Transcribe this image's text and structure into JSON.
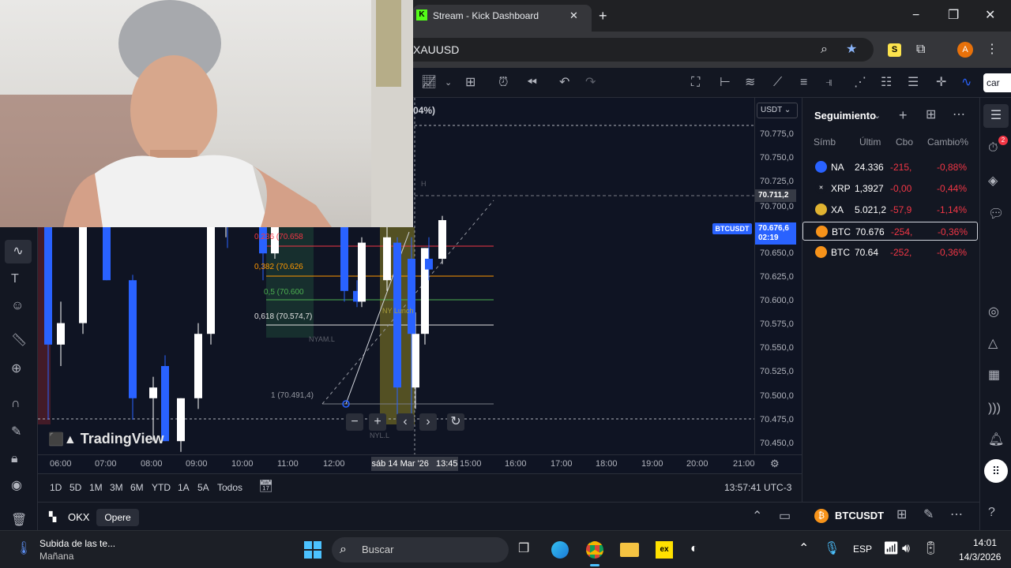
{
  "browser": {
    "tab_title": "Stream - Kick Dashboard",
    "address": "XAUUSD",
    "profile_initial": "A"
  },
  "toolbar": {
    "search_button": "car"
  },
  "chart": {
    "percent_partial": "04%)",
    "currency": "USDT",
    "symbol_badge": "BTCUSDT",
    "current_price": "70.676,6",
    "countdown": "02:19",
    "crosshair_price": "70.711,2",
    "watermark": "TradingView",
    "fib": {
      "l0236": "0,236 (70.658",
      "l0382": "0,382 (70.626",
      "l05": "0,5 (70.600",
      "l0618": "0,618 (70.574,7)",
      "l1": "1 (70.491,4)"
    },
    "labels": {
      "nyam": "NYAM.L",
      "nylunch": "NY Lunch",
      "nyl": "NYL.L",
      "h": "H"
    },
    "price_ticks": [
      "70.775,0",
      "70.750,0",
      "70.725,0",
      "70.700,0",
      "70.650,0",
      "70.625,0",
      "70.600,0",
      "70.575,0",
      "70.550,0",
      "70.525,0",
      "70.500,0",
      "70.475,0",
      "70.450,0"
    ],
    "time_ticks": [
      "06:00",
      "07:00",
      "08:00",
      "09:00",
      "10:00",
      "11:00",
      "12:00",
      "15:00",
      "16:00",
      "17:00",
      "18:00",
      "19:00",
      "20:00",
      "21:00"
    ],
    "crosshair_date": "sáb 14 Mar '26",
    "crosshair_time": "13:45"
  },
  "chart_data": {
    "type": "candlestick",
    "title": "BTCUSDT",
    "ylim": [
      70440,
      70790
    ],
    "candles": [
      {
        "t": "05:45",
        "o": 70560,
        "h": 70690,
        "l": 70490,
        "c": 70680,
        "dir": "down"
      },
      {
        "t": "06:00",
        "o": 70560,
        "h": 70600,
        "l": 70540,
        "c": 70580,
        "dir": "up"
      },
      {
        "t": "06:15",
        "o": 70580,
        "h": 70690,
        "l": 70570,
        "c": 70690,
        "dir": "up"
      },
      {
        "t": "06:30",
        "o": 70690,
        "h": 70710,
        "l": 70620,
        "c": 70620,
        "dir": "down"
      },
      {
        "t": "06:45",
        "o": 70620,
        "h": 70625,
        "l": 70490,
        "c": 70510,
        "dir": "down"
      },
      {
        "t": "07:00",
        "o": 70510,
        "h": 70530,
        "l": 70470,
        "c": 70520,
        "dir": "up"
      },
      {
        "t": "07:15",
        "o": 70540,
        "h": 70550,
        "l": 70470,
        "c": 70470,
        "dir": "down"
      },
      {
        "t": "07:30",
        "o": 70470,
        "h": 70510,
        "l": 70460,
        "c": 70510,
        "dir": "up"
      },
      {
        "t": "07:45",
        "o": 70510,
        "h": 70580,
        "l": 70500,
        "c": 70570,
        "dir": "up"
      },
      {
        "t": "08:00",
        "o": 70570,
        "h": 70690,
        "l": 70560,
        "c": 70680,
        "dir": "up"
      },
      {
        "t": "08:15",
        "o": 70680,
        "h": 70700,
        "l": 70650,
        "c": 70670,
        "dir": "down"
      },
      {
        "t": "08:30",
        "o": 70670,
        "h": 70700,
        "l": 70660,
        "c": 70700,
        "dir": "up"
      },
      {
        "t": "09:30",
        "o": 70690,
        "h": 70700,
        "l": 70620,
        "c": 70645,
        "dir": "down"
      },
      {
        "t": "09:45",
        "o": 70645,
        "h": 70700,
        "l": 70640,
        "c": 70690,
        "dir": "up"
      },
      {
        "t": "11:30",
        "o": 70690,
        "h": 70700,
        "l": 70600,
        "c": 70610,
        "dir": "down"
      },
      {
        "t": "11:45",
        "o": 70610,
        "h": 70620,
        "l": 70595,
        "c": 70600,
        "dir": "down"
      },
      {
        "t": "12:00",
        "o": 70600,
        "h": 70660,
        "l": 70595,
        "c": 70655,
        "dir": "up"
      },
      {
        "t": "12:15",
        "o": 70660,
        "h": 70680,
        "l": 70610,
        "c": 70620,
        "dir": "up"
      },
      {
        "t": "12:30",
        "o": 70655,
        "h": 70660,
        "l": 70491,
        "c": 70520,
        "dir": "down"
      },
      {
        "t": "12:45",
        "o": 70520,
        "h": 70590,
        "l": 70500,
        "c": 70570,
        "dir": "up"
      },
      {
        "t": "13:00",
        "o": 70570,
        "h": 70660,
        "l": 70491,
        "c": 70640,
        "dir": "down"
      },
      {
        "t": "13:15",
        "o": 70570,
        "h": 70650,
        "l": 70560,
        "c": 70650,
        "dir": "up"
      },
      {
        "t": "13:30",
        "o": 70630,
        "h": 70660,
        "l": 70620,
        "c": 70640,
        "dir": "down"
      },
      {
        "t": "13:45",
        "o": 70640,
        "h": 70680,
        "l": 70635,
        "c": 70676,
        "dir": "up"
      }
    ],
    "fib_levels": [
      {
        "ratio": 0.236,
        "price": 70658
      },
      {
        "ratio": 0.382,
        "price": 70626
      },
      {
        "ratio": 0.5,
        "price": 70600
      },
      {
        "ratio": 0.618,
        "price": 70574.7
      },
      {
        "ratio": 1,
        "price": 70491.4
      }
    ]
  },
  "ranges": [
    "1D",
    "5D",
    "1M",
    "3M",
    "6M",
    "YTD",
    "1A",
    "5A",
    "Todos"
  ],
  "clock": "13:57:41 UTC-3",
  "broker": {
    "name": "OKX",
    "trade": "Opere"
  },
  "watchlist": {
    "title": "Seguimiento",
    "headers": [
      "Símb",
      "Últim",
      "Cbo",
      "Cambio%"
    ],
    "rows": [
      {
        "sym": "NA",
        "last": "24.336",
        "chg": "-215,",
        "pct": "-0,88%",
        "badge": "100"
      },
      {
        "sym": "XRP",
        "last": "1,3927",
        "chg": "-0,00",
        "pct": "-0,44%",
        "badge": "X"
      },
      {
        "sym": "XA",
        "last": "5.021,2",
        "chg": "-57,9",
        "pct": "-1,14%",
        "badge": "Au"
      },
      {
        "sym": "BTC",
        "last": "70.676",
        "chg": "-254,",
        "pct": "-0,36%",
        "badge": "B"
      },
      {
        "sym": "BTC",
        "last": "70.64",
        "chg": "-252,",
        "pct": "-0,36%",
        "badge": "B"
      }
    ],
    "footer_symbol": "BTCUSDT",
    "notif_count": "2"
  },
  "taskbar": {
    "news_title": "Subida de las te...",
    "news_sub": "Mañana",
    "search": "Buscar",
    "lang": "ESP",
    "time": "14:01",
    "date": "14/3/2026"
  },
  "colors": {
    "up": "#ffffff",
    "down": "#2962ff",
    "neg": "#f23645",
    "accent": "#2962ff"
  }
}
